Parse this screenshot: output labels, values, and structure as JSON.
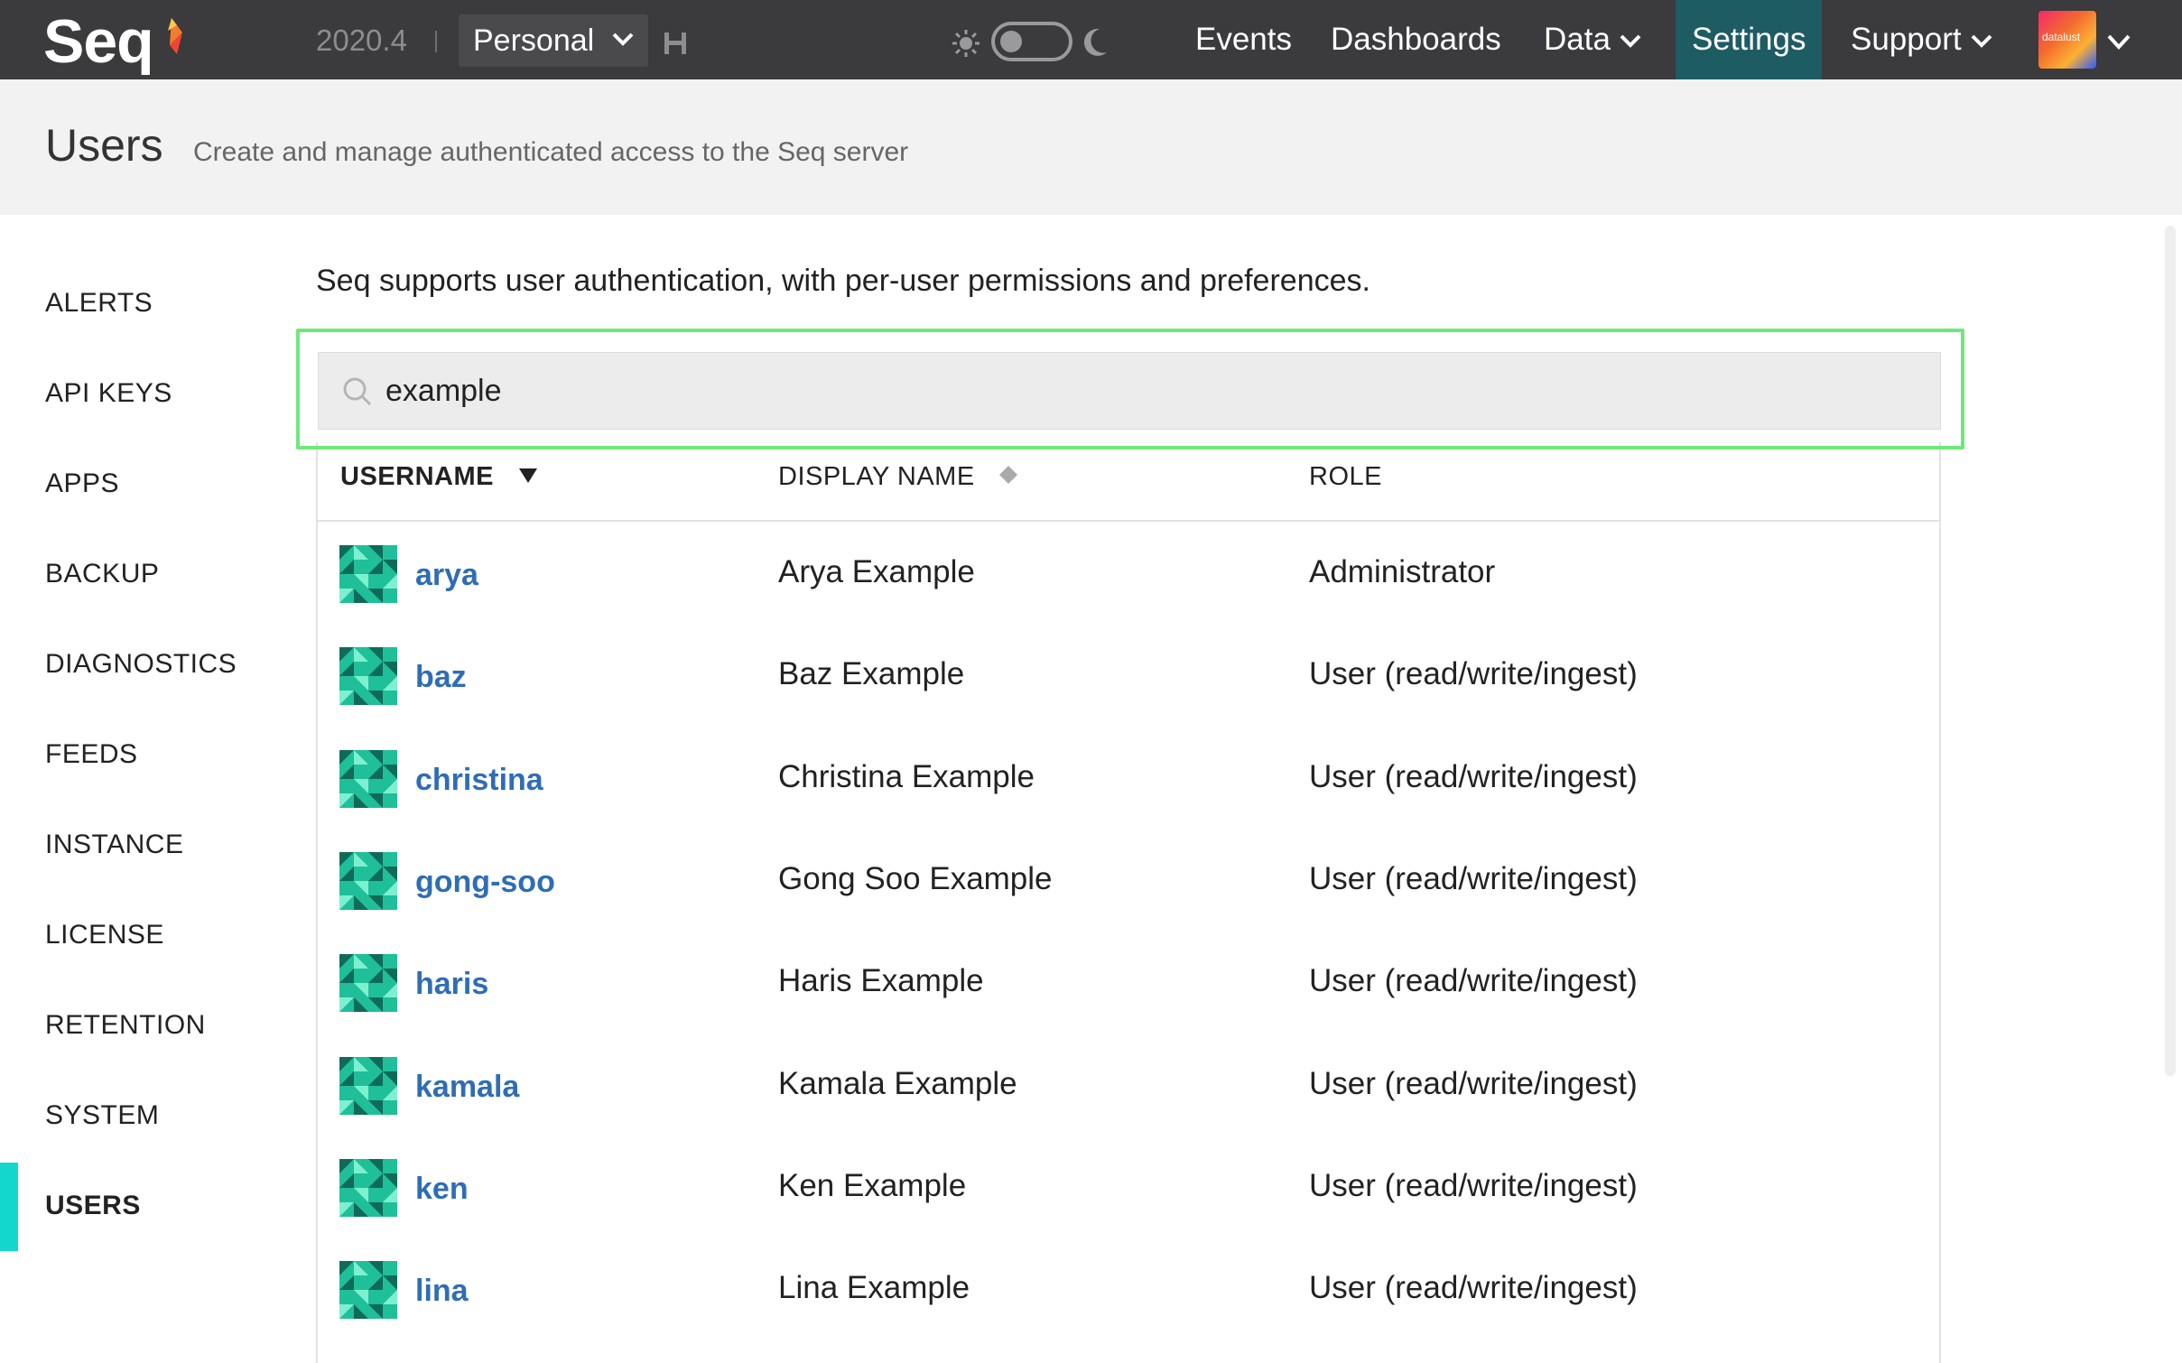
{
  "app": {
    "logo": "Seq",
    "version": "2020.4",
    "workspace": "Personal",
    "account_label": "datalust"
  },
  "nav": {
    "items": [
      {
        "label": "Events"
      },
      {
        "label": "Dashboards"
      },
      {
        "label": "Data"
      },
      {
        "label": "Settings"
      },
      {
        "label": "Support"
      }
    ]
  },
  "header": {
    "title": "Users",
    "subtitle": "Create and manage authenticated access to the Seq server"
  },
  "sidebar": {
    "items": [
      {
        "label": "ALERTS"
      },
      {
        "label": "API KEYS"
      },
      {
        "label": "APPS"
      },
      {
        "label": "BACKUP"
      },
      {
        "label": "DIAGNOSTICS"
      },
      {
        "label": "FEEDS"
      },
      {
        "label": "INSTANCE"
      },
      {
        "label": "LICENSE"
      },
      {
        "label": "RETENTION"
      },
      {
        "label": "SYSTEM"
      },
      {
        "label": "USERS"
      }
    ]
  },
  "main": {
    "intro": "Seq supports user authentication, with per-user permissions and preferences.",
    "search": {
      "value": "example"
    },
    "columns": {
      "username": "USERNAME",
      "display_name": "DISPLAY NAME",
      "role": "ROLE"
    },
    "rows": [
      {
        "username": "arya",
        "display_name": "Arya Example",
        "role": "Administrator"
      },
      {
        "username": "baz",
        "display_name": "Baz Example",
        "role": "User (read/write/ingest)"
      },
      {
        "username": "christina",
        "display_name": "Christina Example",
        "role": "User (read/write/ingest)"
      },
      {
        "username": "gong-soo",
        "display_name": "Gong Soo Example",
        "role": "User (read/write/ingest)"
      },
      {
        "username": "haris",
        "display_name": "Haris Example",
        "role": "User (read/write/ingest)"
      },
      {
        "username": "kamala",
        "display_name": "Kamala Example",
        "role": "User (read/write/ingest)"
      },
      {
        "username": "ken",
        "display_name": "Ken Example",
        "role": "User (read/write/ingest)"
      },
      {
        "username": "lina",
        "display_name": "Lina Example",
        "role": "User (read/write/ingest)"
      }
    ]
  },
  "colors": {
    "topbar": "#3b3a3d",
    "active_nav": "#1e5c63",
    "accent": "#12d7cc",
    "link": "#2f6db5",
    "search_highlight": "#6fe87a"
  }
}
